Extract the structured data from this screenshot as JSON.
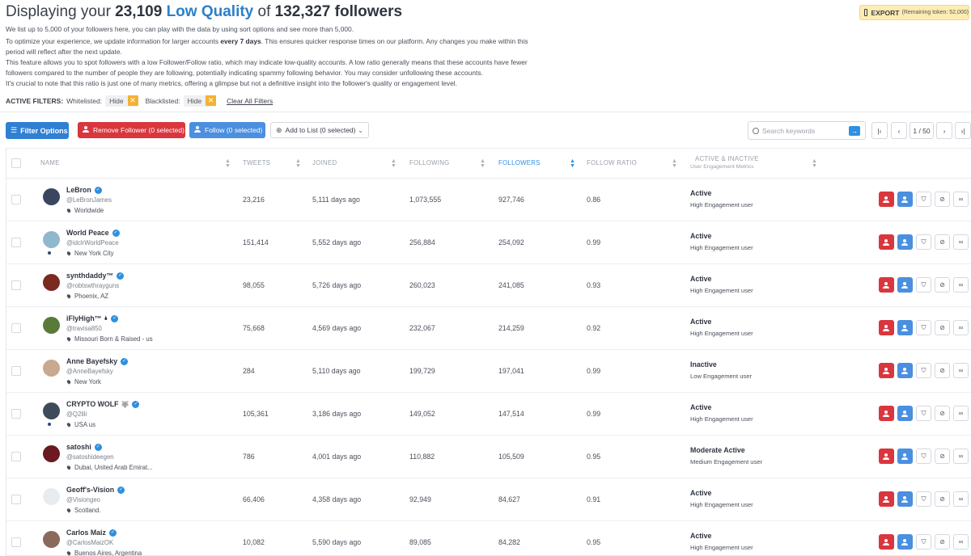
{
  "header": {
    "title_prefix": "Displaying your ",
    "title_count": "23,109",
    "title_quality": "Low Quality",
    "title_mid": " of ",
    "title_total": "132,327 followers",
    "p1": "We list up to 5,000 of your followers here, you can play with the data by using sort options and see more than 5,000.",
    "p2a": "To optimize your experience, we update information for larger accounts ",
    "p2b": "every 7 days",
    "p2c": ". This ensures quicker response times on our platform. Any changes you make within this",
    "p2d": "period will reflect after the next update.",
    "p3a": "This feature allows you to spot followers with a low Follower/Follow ratio, which may indicate low-quality accounts. A low ratio generally means that these accounts have fewer",
    "p3b": "followers compared to the number of people they are following, potentially indicating spammy following behavior. You may consider unfollowing these accounts.",
    "p4": "It's crucial to note that this ratio is just one of many metrics, offering a glimpse but not a definitive insight into the follower's quality or engagement level."
  },
  "export": {
    "label": "EXPORT",
    "remaining": "(Remaining token: 52,000)"
  },
  "filters": {
    "label": "ACTIVE FILTERS:",
    "whitelisted_label": "Whitelisted:",
    "whitelisted_value": "Hide",
    "blacklisted_label": "Blacklisted:",
    "blacklisted_value": "Hide",
    "clear_all": "Clear All Filters"
  },
  "toolbar": {
    "filter_options": "Filter Options",
    "remove_follower": "Remove Follower (0 selected)",
    "follow": "Follow (0 selected)",
    "add_to_list": "Add to List (0 selected)",
    "search_placeholder": "Search keywords",
    "page_indicator": "1 / 50"
  },
  "columns": {
    "name": "NAME",
    "tweets": "TWEETS",
    "joined": "JOINED",
    "following": "FOLLOWING",
    "followers": "FOLLOWERS",
    "follow_ratio": "FOLLOW RATIO",
    "activity": "ACTIVE & INACTIVE",
    "activity_sub": "User Engagement Metrics"
  },
  "rows": [
    {
      "name": "LeBron",
      "emoji": "",
      "handle": "@LeBronJames",
      "location": "Worldwide",
      "tweets": "23,216",
      "joined": "5,111 days ago",
      "following": "1,073,555",
      "followers": "927,746",
      "ratio": "0.86",
      "status": "Active",
      "engagement": "High Engagement user",
      "avatar_color": "#3a4660",
      "online": false
    },
    {
      "name": "World Peace",
      "emoji": "",
      "handle": "@idclrWorldPeace",
      "location": "New York City",
      "tweets": "151,414",
      "joined": "5,552 days ago",
      "following": "256,884",
      "followers": "254,092",
      "ratio": "0.99",
      "status": "Active",
      "engagement": "High Engagement user",
      "avatar_color": "#8fb8cc",
      "online": true
    },
    {
      "name": "synthdaddy™",
      "emoji": "",
      "handle": "@robtswthrayguns",
      "location": "Phoenix, AZ",
      "tweets": "98,055",
      "joined": "5,726 days ago",
      "following": "260,023",
      "followers": "241,085",
      "ratio": "0.93",
      "status": "Active",
      "engagement": "High Engagement user",
      "avatar_color": "#7a2a20",
      "online": false
    },
    {
      "name": "iFlyHigh™",
      "emoji": "🌢",
      "handle": "@travisa850",
      "location": "Missouri Born & Raised - us",
      "tweets": "75,668",
      "joined": "4,569 days ago",
      "following": "232,067",
      "followers": "214,259",
      "ratio": "0.92",
      "status": "Active",
      "engagement": "High Engagement user",
      "avatar_color": "#5a7a3a",
      "online": false
    },
    {
      "name": "Anne Bayefsky",
      "emoji": "",
      "handle": "@AnneBayefsky",
      "location": "New York",
      "tweets": "284",
      "joined": "5,110 days ago",
      "following": "199,729",
      "followers": "197,041",
      "ratio": "0.99",
      "status": "Inactive",
      "engagement": "Low Engagement user",
      "avatar_color": "#c9a890",
      "online": false
    },
    {
      "name": "CRYPTO WOLF",
      "emoji": "🐺",
      "handle": "@Q2lili",
      "location": "USA us",
      "tweets": "105,361",
      "joined": "3,186 days ago",
      "following": "149,052",
      "followers": "147,514",
      "ratio": "0.99",
      "status": "Active",
      "engagement": "High Engagement user",
      "avatar_color": "#3c4a5a",
      "online": true
    },
    {
      "name": "satoshi",
      "emoji": "",
      "handle": "@satoshideegen",
      "location": "Dubai, United Arab Emirat...",
      "tweets": "786",
      "joined": "4,001 days ago",
      "following": "110,882",
      "followers": "105,509",
      "ratio": "0.95",
      "status": "Moderate Active",
      "engagement": "Medium Engagement user",
      "avatar_color": "#6a1a20",
      "online": false
    },
    {
      "name": "Geoff's-Vision",
      "emoji": "",
      "handle": "@Visiongeo",
      "location": "Scotland.",
      "tweets": "66,406",
      "joined": "4,358 days ago",
      "following": "92,949",
      "followers": "84,627",
      "ratio": "0.91",
      "status": "Active",
      "engagement": "High Engagement user",
      "avatar_color": "#e9ecef",
      "online": false
    },
    {
      "name": "Carlos Maiz",
      "emoji": "",
      "handle": "@CarlosMaizOK",
      "location": "Buenos Aires, Argentina",
      "tweets": "10,082",
      "joined": "5,590 days ago",
      "following": "89,085",
      "followers": "84,282",
      "ratio": "0.95",
      "status": "Active",
      "engagement": "High Engagement user",
      "avatar_color": "#8a6a5a",
      "online": false
    }
  ],
  "icons": {
    "remove": "remove-user-icon",
    "follow": "add-user-icon",
    "whitelist": "shield-icon",
    "blacklist": "ban-icon",
    "link": "link-icon"
  },
  "colors": {
    "accent_blue": "#2d7fc7",
    "remove_red": "#d9363e",
    "follow_blue": "#4a8fe0",
    "export_yellow": "#fdecb3",
    "chip_orange": "#f3b234"
  }
}
